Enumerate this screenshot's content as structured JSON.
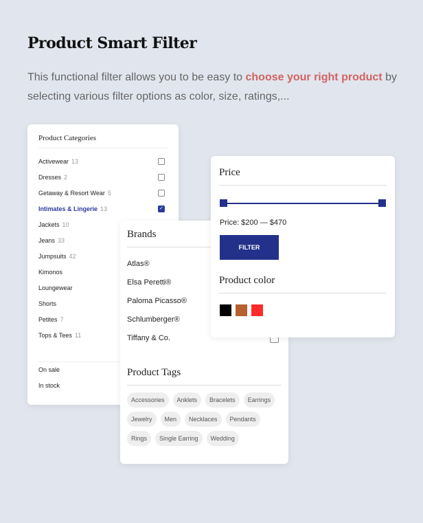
{
  "header": {
    "title": "Product Smart Filter",
    "desc_pre": "This functional filter allows you to be easy to ",
    "desc_highlight": "choose your right product",
    "desc_post": " by selecting various filter options as color, size, ratings,..."
  },
  "categories": {
    "title": "Product Categories",
    "items": [
      {
        "label": "Activewear",
        "count": "13",
        "checked": false
      },
      {
        "label": "Dresses",
        "count": "2",
        "checked": false
      },
      {
        "label": "Getaway & Resort Wear",
        "count": "5",
        "checked": false
      },
      {
        "label": "Intimates & Lingerie",
        "count": "13",
        "checked": true
      },
      {
        "label": "Jackets",
        "count": "10"
      },
      {
        "label": "Jeans",
        "count": "33"
      },
      {
        "label": "Jumpsuits",
        "count": "42"
      },
      {
        "label": "Kimonos",
        "count": ""
      },
      {
        "label": "Loungewear",
        "count": ""
      },
      {
        "label": "Shorts",
        "count": ""
      },
      {
        "label": "Petites",
        "count": "7"
      },
      {
        "label": "Tops & Tees",
        "count": "11"
      }
    ],
    "stock": [
      "On sale",
      "In stock"
    ]
  },
  "brands": {
    "title": "Brands",
    "items": [
      "Atlas®",
      "Elsa Peretti®",
      "Paloma Picasso®",
      "Schlumberger®",
      "Tiffany & Co."
    ]
  },
  "tags": {
    "title": "Product Tags",
    "items": [
      "Accessories",
      "Anklets",
      "Bracelets",
      "Earrings",
      "Jewelry",
      "Men",
      "Necklaces",
      "Pendants",
      "Rings",
      "Single Earring",
      "Wedding"
    ]
  },
  "price": {
    "title": "Price",
    "label": "Price: $200 — $470",
    "min": 200,
    "max": 470,
    "filter_label": "FILTER"
  },
  "color": {
    "title": "Product color",
    "swatches": [
      "#000000",
      "#b5602e",
      "#ff2b2b"
    ]
  },
  "accent": "#23318a"
}
